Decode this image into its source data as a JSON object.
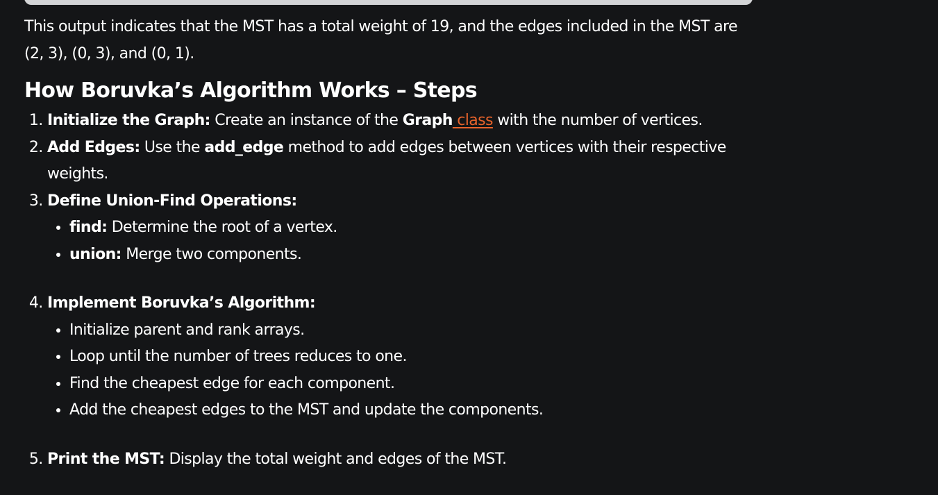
{
  "intro": {
    "line": "This output indicates that the MST has a total weight of 19, and the edges included in the MST are (2, 3), (0, 3), and (0, 1)."
  },
  "heading": "How Boruvka’s Algorithm Works – Steps",
  "steps": [
    {
      "title": "Initialize the Graph:",
      "text_before": " Create an instance of the ",
      "bold": "Graph",
      "link": " class",
      "text_after": " with the number of vertices."
    },
    {
      "title": "Add Edges:",
      "text_before": " Use the ",
      "bold": "add_edge",
      "text_after": " method to add edges between vertices with their respective weights."
    },
    {
      "title": "Define Union-Find Operations:",
      "sub": [
        {
          "bold": "find:",
          "text": " Determine the root of a vertex."
        },
        {
          "bold": "union:",
          "text": " Merge two components."
        }
      ]
    },
    {
      "title": "Implement Boruvka’s Algorithm:",
      "sub": [
        {
          "text": "Initialize parent and rank arrays."
        },
        {
          "text": "Loop until the number of trees reduces to one."
        },
        {
          "text": "Find the cheapest edge for each component."
        },
        {
          "text": "Add the cheapest edges to the MST and update the components."
        }
      ]
    },
    {
      "title": "Print the MST:",
      "text": " Display the total weight and edges of the MST."
    }
  ],
  "colors": {
    "background": "#141517",
    "link": "#e8632b",
    "code_box": "#d3d4d6"
  }
}
